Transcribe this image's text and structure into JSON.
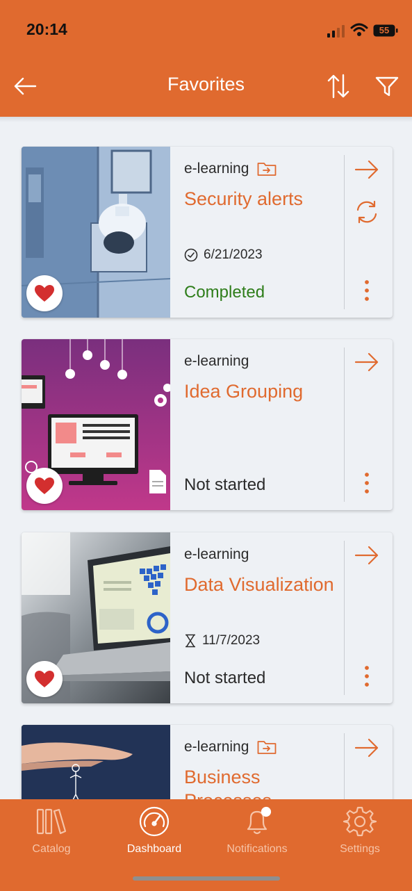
{
  "status_bar": {
    "time": "20:14",
    "battery": "55"
  },
  "header": {
    "title": "Favorites",
    "background_color": "#e06a2f",
    "back_icon": "arrow-left-icon",
    "sort_icon": "sort-arrows-icon",
    "filter_icon": "filter-funnel-icon"
  },
  "cards": [
    {
      "type": "e-learning",
      "has_folder_icon": true,
      "title": "Security alerts",
      "date": "6/21/2023",
      "date_icon": "check-circle-icon",
      "status": "Completed",
      "favorite": true,
      "actions": [
        "arrow-right-icon",
        "refresh-icon",
        "more-vertical-icon"
      ]
    },
    {
      "type": "e-learning",
      "has_folder_icon": false,
      "title": "Idea Grouping",
      "date": "",
      "status": "Not started",
      "favorite": true,
      "actions": [
        "arrow-right-icon",
        "more-vertical-icon"
      ]
    },
    {
      "type": "e-learning",
      "has_folder_icon": false,
      "title": "Data Visualization",
      "date": "11/7/2023",
      "date_icon": "hourglass-icon",
      "status": "Not started",
      "favorite": true,
      "actions": [
        "arrow-right-icon",
        "more-vertical-icon"
      ]
    },
    {
      "type": "e-learning",
      "has_folder_icon": true,
      "title": "Business Processes",
      "date": "",
      "status": "",
      "favorite": false,
      "actions": [
        "arrow-right-icon"
      ]
    }
  ],
  "bottom_nav": {
    "items": [
      {
        "label": "Catalog",
        "icon": "books-icon",
        "active": false
      },
      {
        "label": "Dashboard",
        "icon": "speedometer-icon",
        "active": true
      },
      {
        "label": "Notifications",
        "icon": "bell-icon",
        "active": false,
        "badge": true
      },
      {
        "label": "Settings",
        "icon": "gear-icon",
        "active": false
      }
    ]
  },
  "colors": {
    "accent": "#e06a2f",
    "completed": "#2e7d1a",
    "heart": "#d32f2f",
    "page_background": "#eef1f5"
  }
}
